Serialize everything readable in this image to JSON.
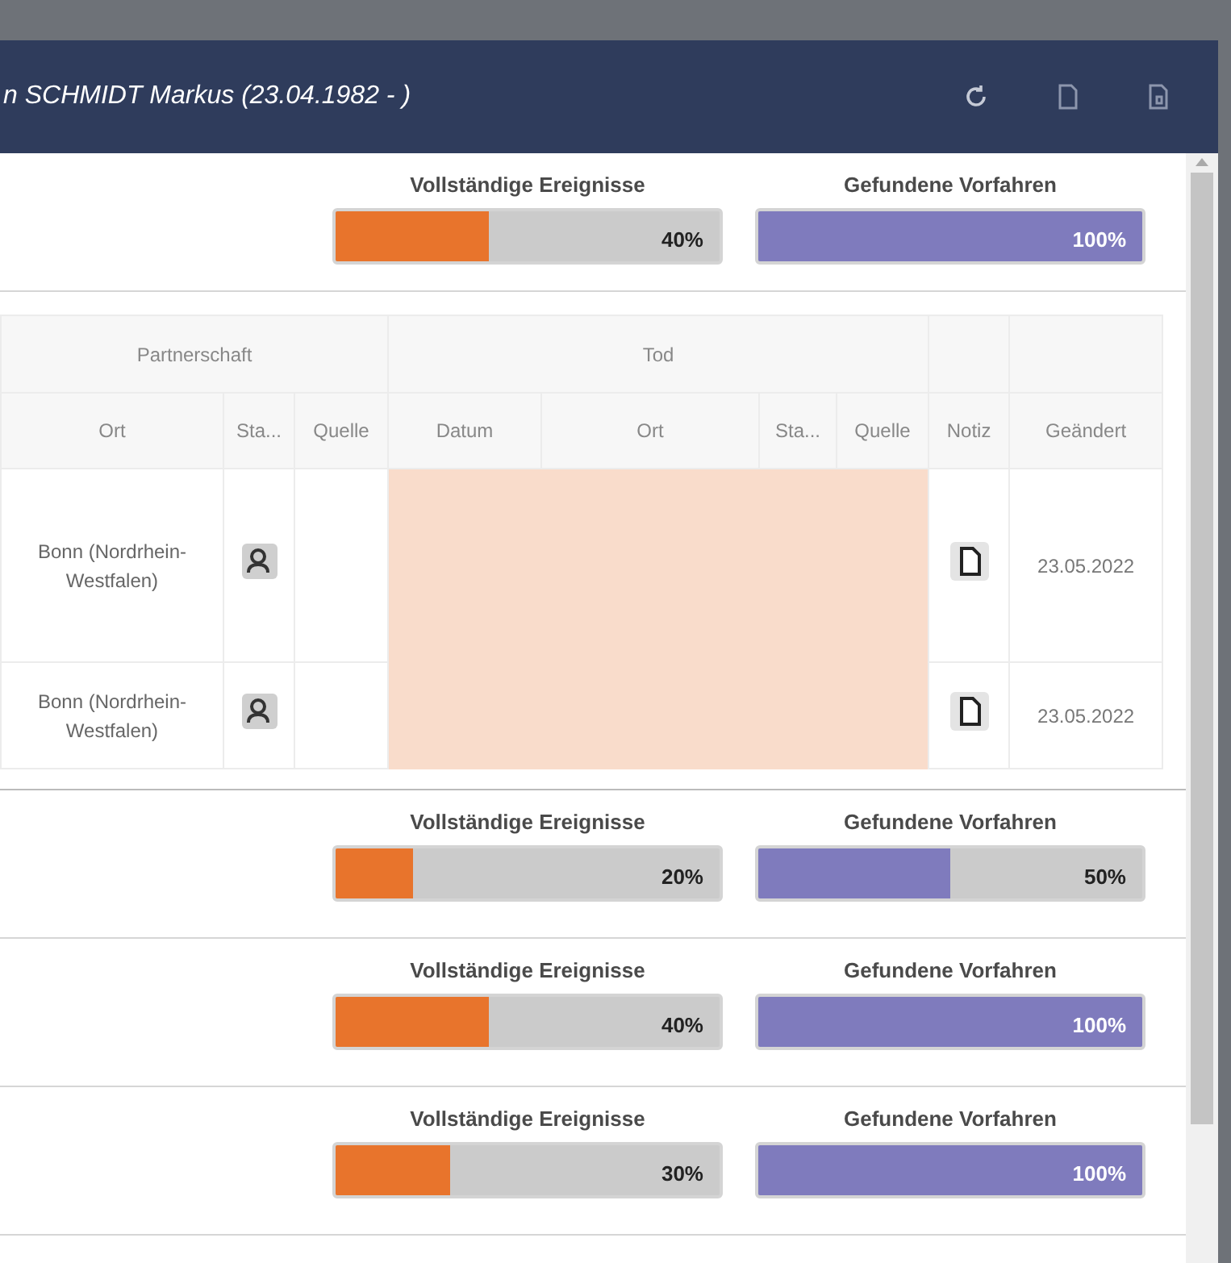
{
  "window": {
    "title": "n SCHMIDT Markus (23.04.1982 - )"
  },
  "summaries": [
    {
      "events": {
        "label": "Vollständige Ereignisse",
        "level": 0.4,
        "reading": "40%"
      },
      "ancestors": {
        "label": "Gefundene Vorfahren",
        "level": 1,
        "reading": "100%"
      }
    }
  ],
  "table": {
    "groups": [
      "Partnerschaft",
      "Tod"
    ],
    "columns": [
      "Ort",
      "Sta...",
      "Quelle",
      "Datum",
      "Ort",
      "Sta...",
      "Quelle",
      "Notiz",
      "Geändert"
    ],
    "rows": [
      {
        "place": "Bonn (Nordrhein-Westfalen)",
        "death_missing": true,
        "changed": "23.05.2022"
      },
      {
        "place": "Bonn (Nordrhein-Westfalen)",
        "death_missing": true,
        "changed": "23.05.2022"
      }
    ]
  },
  "more_summaries": [
    {
      "events": {
        "label": "Vollständige Ereignisse",
        "level": 0.2,
        "reading": "20%"
      },
      "ancestors": {
        "label": "Gefundene Vorfahren",
        "level": 0.5,
        "reading": "50%"
      }
    },
    {
      "events": {
        "label": "Vollständige Ereignisse",
        "level": 0.4,
        "reading": "40%"
      },
      "ancestors": {
        "label": "Gefundene Vorfahren",
        "level": 1,
        "reading": "100%"
      }
    },
    {
      "events": {
        "label": "Vollständige Ereignisse",
        "level": 0.3,
        "reading": "30%"
      },
      "ancestors": {
        "label": "Gefundene Vorfahren",
        "level": 1,
        "reading": "100%"
      }
    }
  ]
}
